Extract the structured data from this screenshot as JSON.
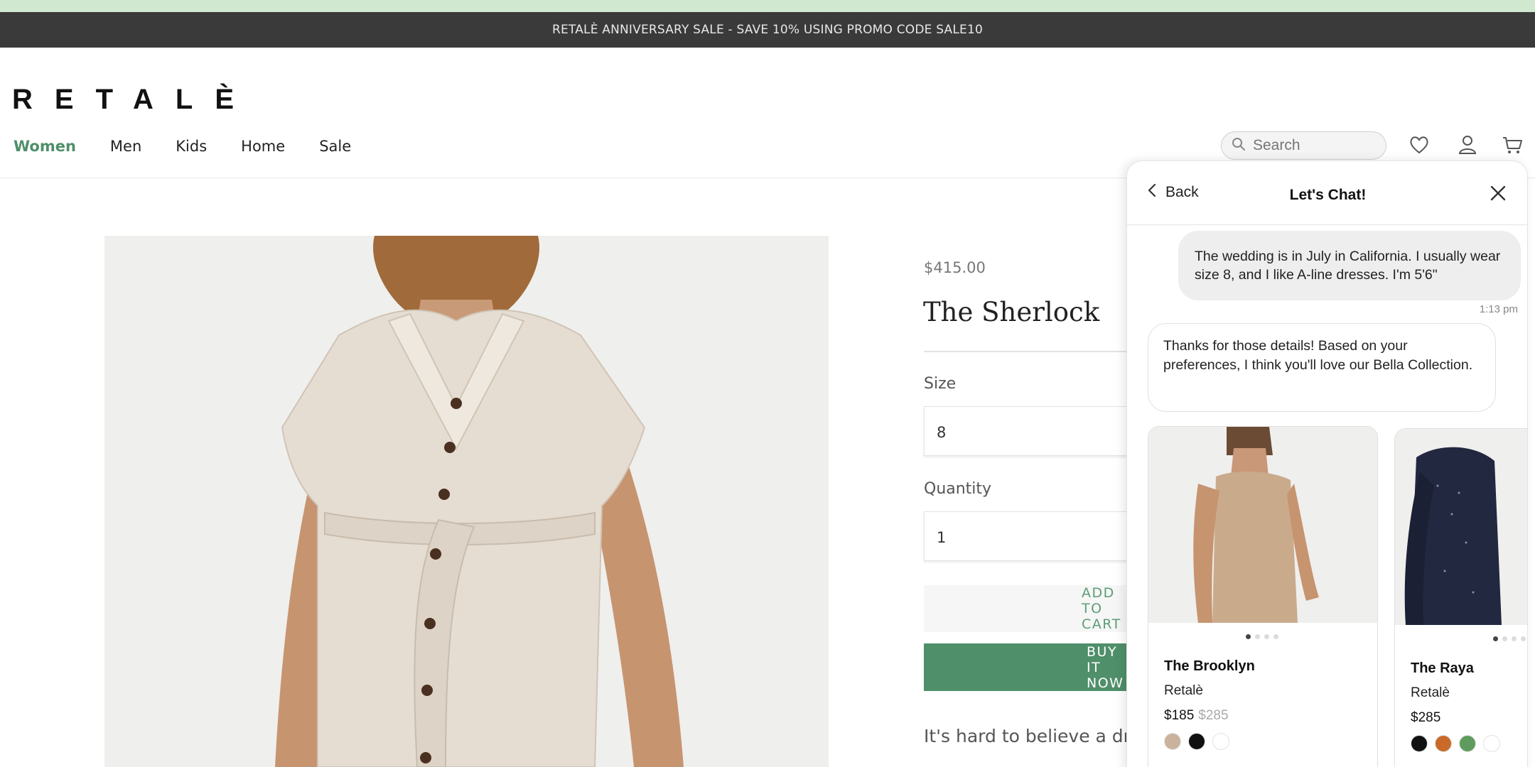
{
  "promo_banner": "RETALÈ ANNIVERSARY SALE - SAVE 10% USING PROMO CODE SALE10",
  "brand": {
    "logo": "RETALÈ"
  },
  "nav": {
    "items": [
      {
        "label": "Women",
        "active": true
      },
      {
        "label": "Men",
        "active": false
      },
      {
        "label": "Kids",
        "active": false
      },
      {
        "label": "Home",
        "active": false
      },
      {
        "label": "Sale",
        "active": false
      }
    ]
  },
  "header": {
    "search_placeholder": "Search",
    "icons": [
      "search-icon",
      "heart-icon",
      "account-icon",
      "cart-icon"
    ]
  },
  "product": {
    "price": "$415.00",
    "title": "The Sherlock",
    "size_label": "Size",
    "size_value": "8",
    "quantity_label": "Quantity",
    "quantity_value": "1",
    "add_to_cart": "ADD TO CART",
    "buy_now": "BUY IT NOW",
    "description": "It's hard to believe a dress like this isn't real! Mid-weight, faux leather..."
  },
  "chat": {
    "back_label": "Back",
    "title": "Let's Chat!",
    "user_message": "The wedding is in July in California. I usually wear size 8, and I like A-line dresses. I'm 5'6\"",
    "user_time": "1:13 pm",
    "bot_message": "Thanks for those details! Based on your preferences, I think you'll love our Bella Collection.",
    "cards": [
      {
        "name": "The Brooklyn",
        "brand": "Retalè",
        "price": "$185",
        "old_price": "$285",
        "image_dots": 4,
        "active_dot": 0,
        "swatches": [
          "#c9b39d",
          "#111111",
          "#ffffff"
        ]
      },
      {
        "name": "The Raya",
        "brand": "Retalè",
        "price": "$285",
        "old_price": "",
        "image_dots": 4,
        "active_dot": 0,
        "swatches": [
          "#111111",
          "#c96a2a",
          "#5e9c5e",
          "#ffffff"
        ]
      }
    ]
  },
  "colors": {
    "accent_green": "#4f8f6a",
    "promo_bg": "#3a3a3a",
    "top_strip": "#cfe8cf"
  }
}
